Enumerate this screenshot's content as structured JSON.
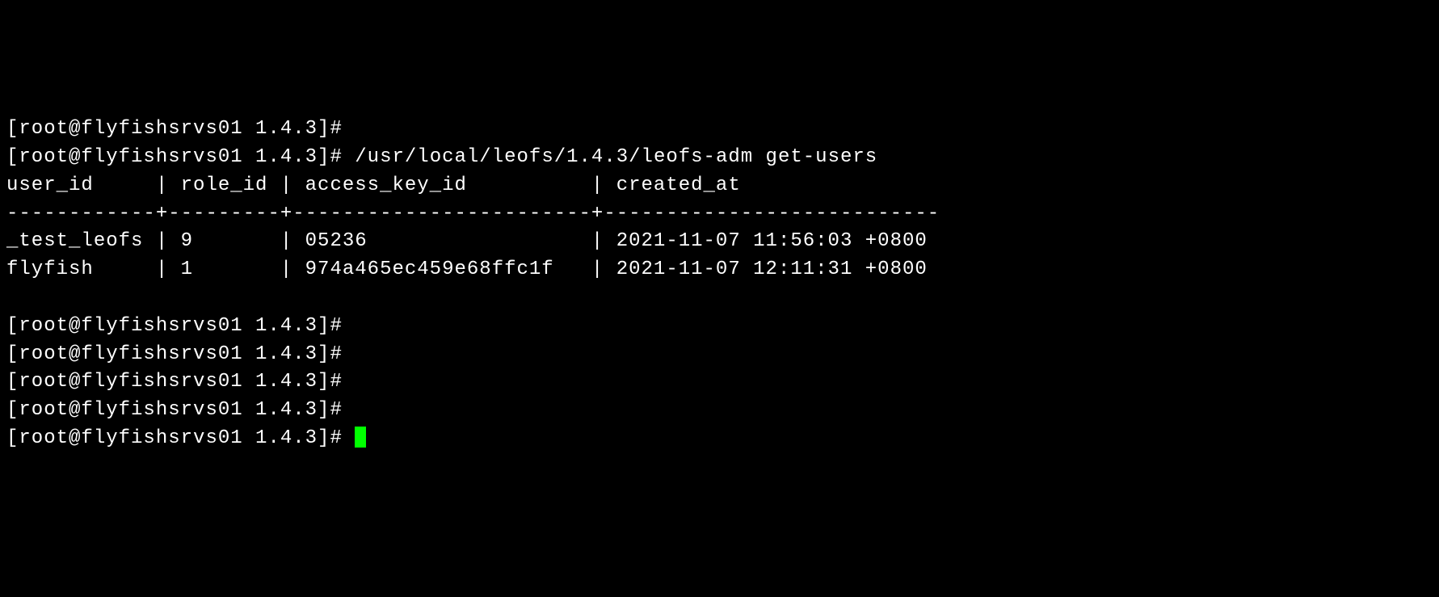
{
  "terminal": {
    "prompt": "[root@flyfishsrvs01 1.4.3]#",
    "command": "/usr/local/leofs/1.4.3/leofs-adm get-users",
    "table": {
      "header": "user_id     | role_id | access_key_id          | created_at",
      "separator": "------------+---------+------------------------+---------------------------",
      "rows": [
        "_test_leofs | 9       | 05236                  | 2021-11-07 11:56:03 +0800",
        "flyfish     | 1       | 974a465ec459e68ffc1f   | 2021-11-07 12:11:31 +0800"
      ]
    },
    "empty_prompts_count": 5
  }
}
